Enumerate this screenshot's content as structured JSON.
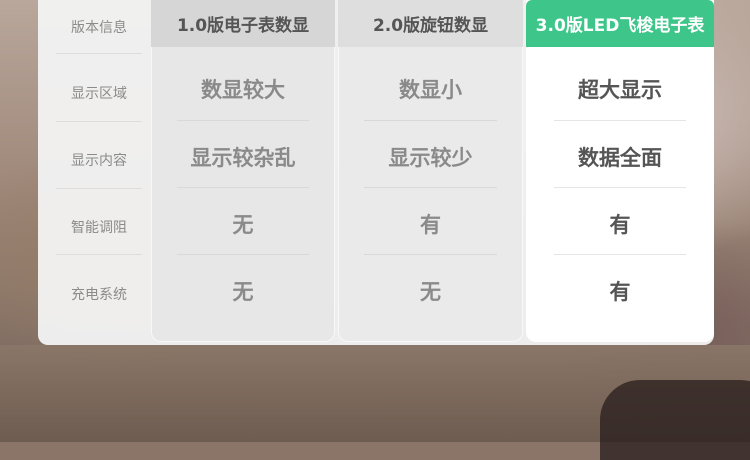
{
  "header_label": "版本信息",
  "row_labels": [
    "显示区域",
    "显示内容",
    "智能调阻",
    "充电系统"
  ],
  "columns": [
    {
      "title": "1.0版电子表数显",
      "cells": [
        "数显较大",
        "显示较杂乱",
        "无",
        "无"
      ]
    },
    {
      "title": "2.0版旋钮数显",
      "cells": [
        "数显小",
        "显示较少",
        "有",
        "无"
      ]
    },
    {
      "title": "3.0版LED飞梭电子表",
      "cells": [
        "超大显示",
        "数据全面",
        "有",
        "有"
      ]
    }
  ],
  "colors": {
    "highlight": "#3ec68a",
    "panel": "#f3f3f3"
  }
}
